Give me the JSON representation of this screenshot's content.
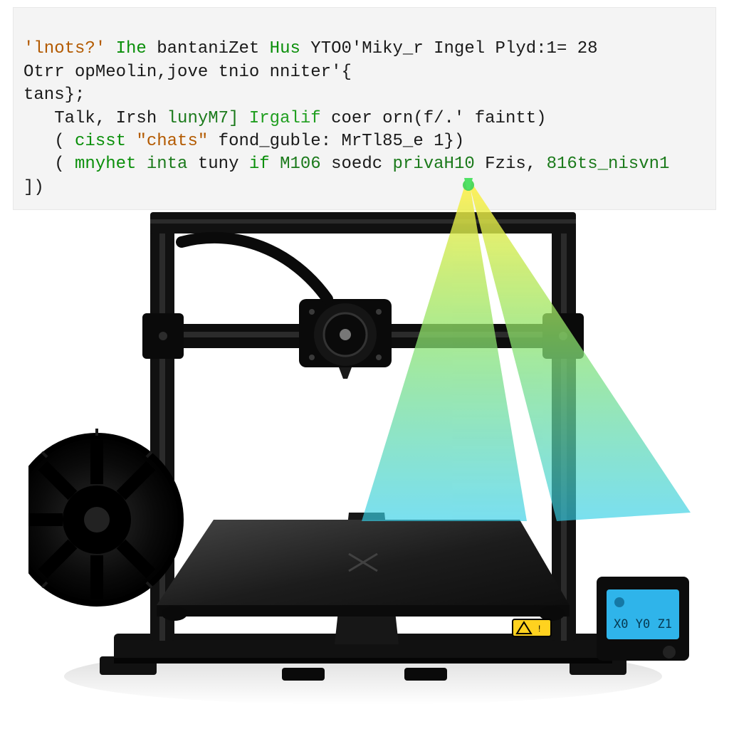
{
  "code": {
    "line1_a": "'lnots?' ",
    "line1_b": "Ihe",
    "line1_c": " bantaniZet ",
    "line1_d": "Hus",
    "line1_e": " YTO0'Miky_r Ingel Plyd:1= ",
    "line1_f": "28",
    "line2_a": "Otrr opMeolin,jove tnio nniter'{",
    "line3_a": "tans};",
    "line4_a": "   Talk, Irsh ",
    "line4_b": "lunyM7]",
    "line4_c": " ",
    "line4_d": "Irgalif",
    "line4_e": " coer orn(f/.' faintt)",
    "line5_a": "   ( ",
    "line5_b": "cisst",
    "line5_c": " ",
    "line5_d": "\"chats\"",
    "line5_e": " fond_guble: MrTl85_e 1})",
    "line6_a": "   ( ",
    "line6_b": "mnyhet",
    "line6_c": " ",
    "line6_d": "inta",
    "line6_e": " tuny ",
    "line6_f": "if",
    "line6_g": " ",
    "line6_h": "M106",
    "line6_i": " soedc ",
    "line6_j": "privaH10",
    "line6_k": " Fzis, ",
    "line6_l": "816ts_nisvn1",
    "line7_a": "])"
  },
  "lcd_text": "X0 Y0 Z1",
  "colors": {
    "frame": "#111111",
    "bed": "#2b2b2b",
    "beam_top": "#ffef3d",
    "beam_mid": "#8de36b",
    "beam_bot": "#35cfe8",
    "lcd": "#2fb4ea"
  }
}
